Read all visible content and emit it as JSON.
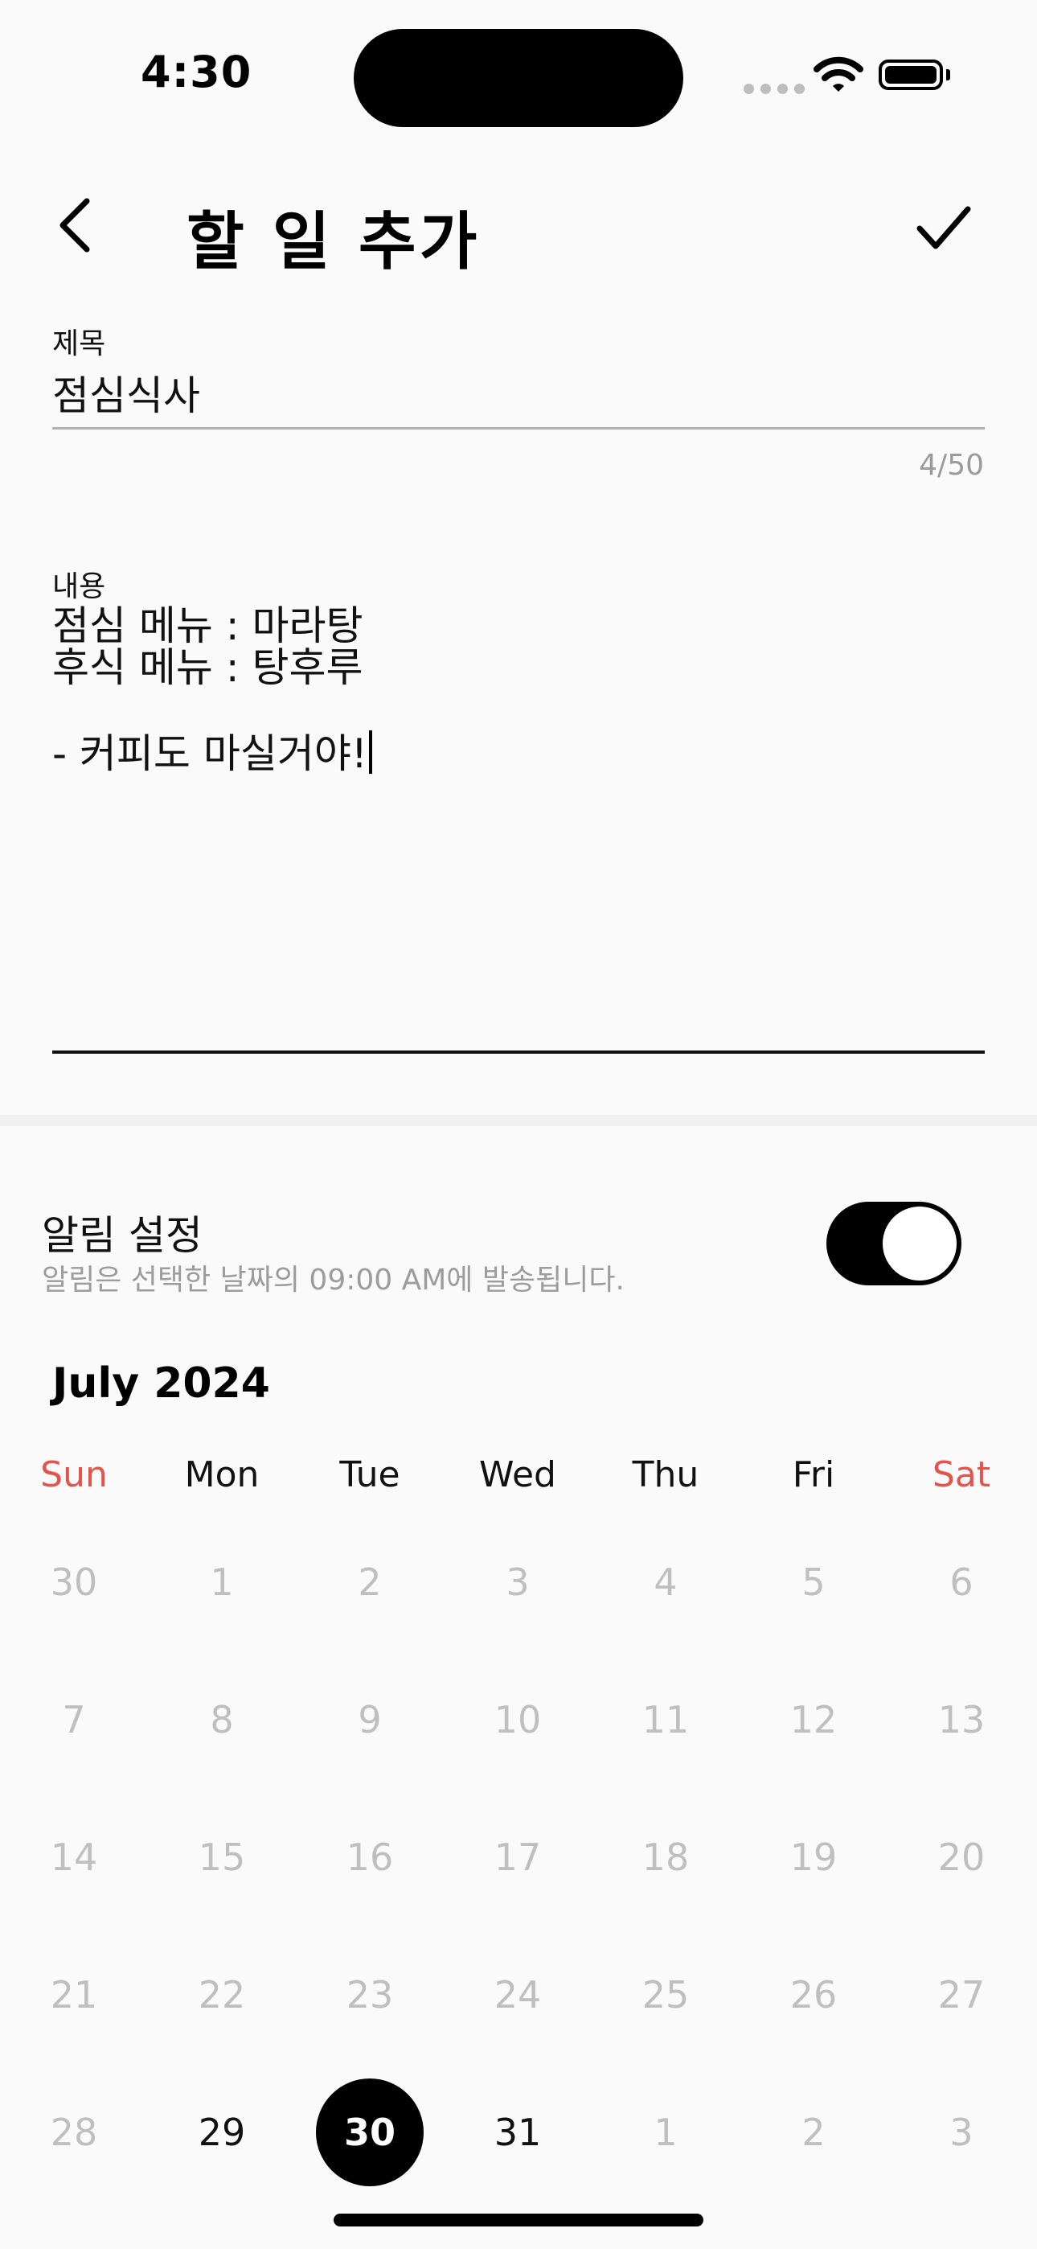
{
  "status_bar": {
    "time": "4:30"
  },
  "header": {
    "title": "할 일 추가"
  },
  "title_field": {
    "label": "제목",
    "value": "점심식사",
    "counter": "4/50"
  },
  "content_field": {
    "label": "내용",
    "value": "점심 메뉴 : 마라탕\n후식 메뉴 : 탕후루\n\n- 커피도 마실거야!"
  },
  "alarm": {
    "title": "알림 설정",
    "subtitle": "알림은 선택한 날짜의 09:00 AM에 발송됩니다.",
    "enabled": true
  },
  "calendar": {
    "month": "July 2024",
    "weekdays": [
      "Sun",
      "Mon",
      "Tue",
      "Wed",
      "Thu",
      "Fri",
      "Sat"
    ],
    "weeks": [
      [
        "30",
        "1",
        "2",
        "3",
        "4",
        "5",
        "6"
      ],
      [
        "7",
        "8",
        "9",
        "10",
        "11",
        "12",
        "13"
      ],
      [
        "14",
        "15",
        "16",
        "17",
        "18",
        "19",
        "20"
      ],
      [
        "21",
        "22",
        "23",
        "24",
        "25",
        "26",
        "27"
      ],
      [
        "28",
        "29",
        "30",
        "31",
        "1",
        "2",
        "3"
      ]
    ],
    "enabled_days": [
      "29",
      "30",
      "31"
    ],
    "selected_day": "30",
    "colors": {
      "weekend": "#e5534b",
      "disabled": "#bfbfbf",
      "selected_bg": "#000000"
    }
  }
}
